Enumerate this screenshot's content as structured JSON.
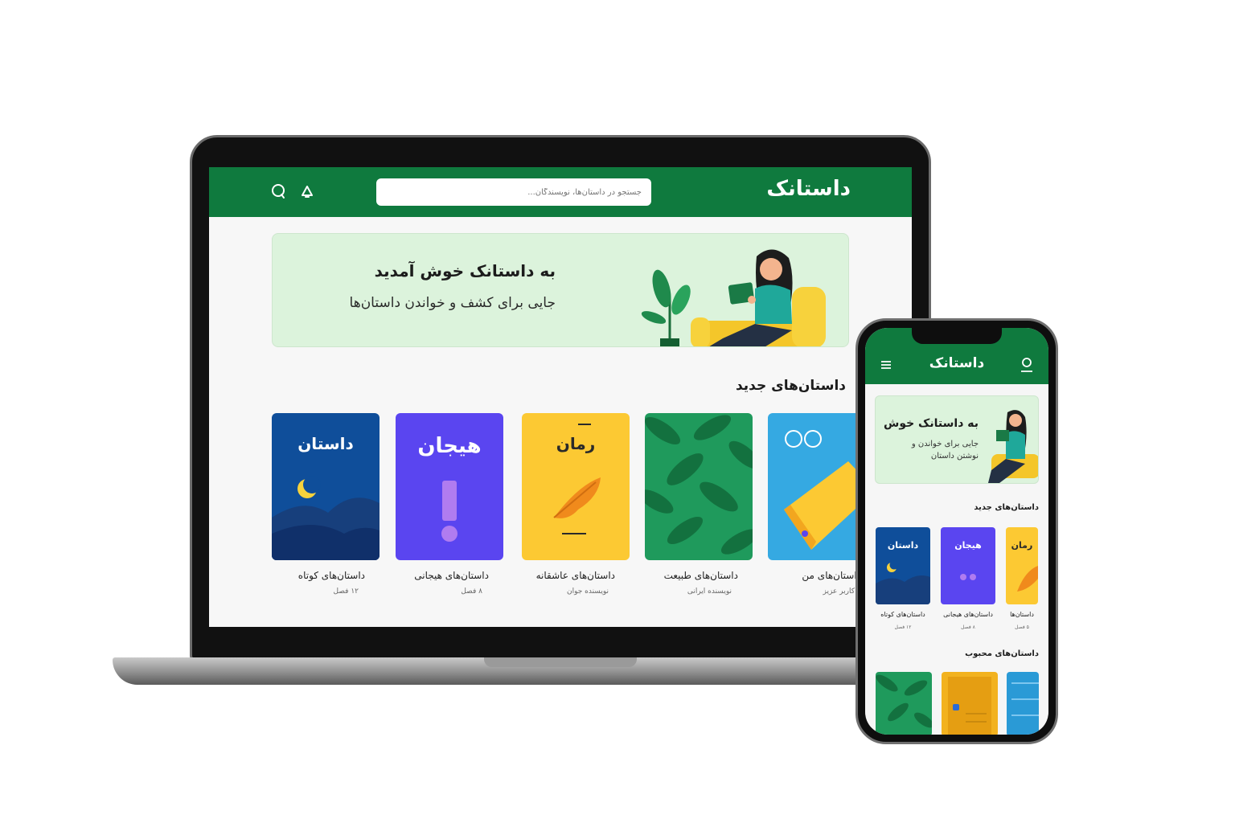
{
  "colors": {
    "brand_green": "#0f7a3e",
    "banner_bg": "#dcf3dc",
    "page_bg": "#f7f7f7"
  },
  "laptop": {
    "header": {
      "logo": "داستانک",
      "search_placeholder": "جستجو در داستان‌ها، نویسندگان...",
      "icons": [
        "chat-icon",
        "bell-icon"
      ]
    },
    "banner": {
      "title": "به داستانک خوش آمدید",
      "subtitle": "جایی برای کشف و خواندن داستان‌ها"
    },
    "section_title": "داستان‌های جدید",
    "books": [
      {
        "cover_title": "داستان",
        "title": "داستان‌های کوتاه",
        "author": "۱۲ فصل",
        "color": "#0f4e9a",
        "motif": "moon-mountains"
      },
      {
        "cover_title": "هیجان",
        "title": "داستان‌های هیجانی",
        "author": "۸ فصل",
        "color": "#5a45f0",
        "motif": "exclamation"
      },
      {
        "cover_title": "رمان",
        "title": "داستان‌های عاشقانه",
        "author": "نویسنده جوان",
        "color": "#fcc933",
        "motif": "feather"
      },
      {
        "cover_title": "",
        "title": "داستان‌های طبیعت",
        "author": "نویسنده ایرانی",
        "color": "#1f9a5c",
        "motif": "leaves"
      },
      {
        "cover_title": "",
        "title": "داستان‌های من",
        "author": "کاربر عزیز",
        "color": "#35a9e2",
        "motif": "book-chat"
      }
    ]
  },
  "phone": {
    "header": {
      "logo": "داستانک",
      "icons": [
        "menu-icon",
        "user-icon"
      ]
    },
    "banner": {
      "title": "به داستانک خوش",
      "subtitle": "جایی برای خواندن و نوشتن داستان"
    },
    "section_new": "داستان‌های جدید",
    "section_popular": "داستان‌های محبوب",
    "books": [
      {
        "cover_title": "داستان",
        "title": "داستان‌های کوتاه",
        "author": "۱۲ فصل",
        "color": "#0f4e9a"
      },
      {
        "cover_title": "هیجان",
        "title": "داستان‌های هیجانی",
        "author": "۸ فصل",
        "color": "#5a45f0"
      },
      {
        "cover_title": "رمان",
        "title": "داستان‌ها",
        "author": "۵ فصل",
        "color": "#fcc933"
      }
    ],
    "popular_books": [
      {
        "color": "#1f9a5c"
      },
      {
        "color": "#f2b21f"
      },
      {
        "color": "#2a9ad6"
      }
    ]
  }
}
